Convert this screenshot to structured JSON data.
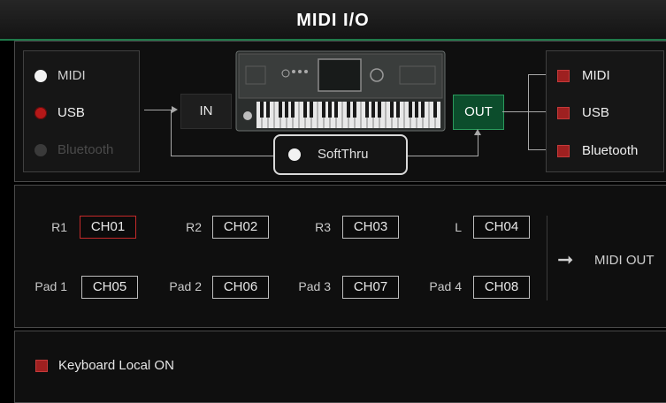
{
  "title": "MIDI I/O",
  "input_sources": [
    {
      "label": "MIDI",
      "state": "enabled"
    },
    {
      "label": "USB",
      "state": "selected"
    },
    {
      "label": "Bluetooth",
      "state": "disabled"
    }
  ],
  "in_label": "IN",
  "out_label": "OUT",
  "soft_thru_label": "SoftThru",
  "outputs": [
    {
      "label": "MIDI"
    },
    {
      "label": "USB"
    },
    {
      "label": "Bluetooth"
    }
  ],
  "channels": [
    {
      "label": "R1",
      "value": "CH01",
      "selected": true
    },
    {
      "label": "R2",
      "value": "CH02"
    },
    {
      "label": "R3",
      "value": "CH03"
    },
    {
      "label": "L",
      "value": "CH04"
    },
    {
      "label": "Pad 1",
      "value": "CH05"
    },
    {
      "label": "Pad 2",
      "value": "CH06"
    },
    {
      "label": "Pad 3",
      "value": "CH07"
    },
    {
      "label": "Pad 4",
      "value": "CH08"
    }
  ],
  "midi_out_label": "MIDI OUT",
  "keyboard_local_label": "Keyboard Local ON",
  "colors": {
    "accent_green": "#1f7a4a",
    "checkbox_red": "#9e2020",
    "out_button": "#0c4d2c"
  }
}
